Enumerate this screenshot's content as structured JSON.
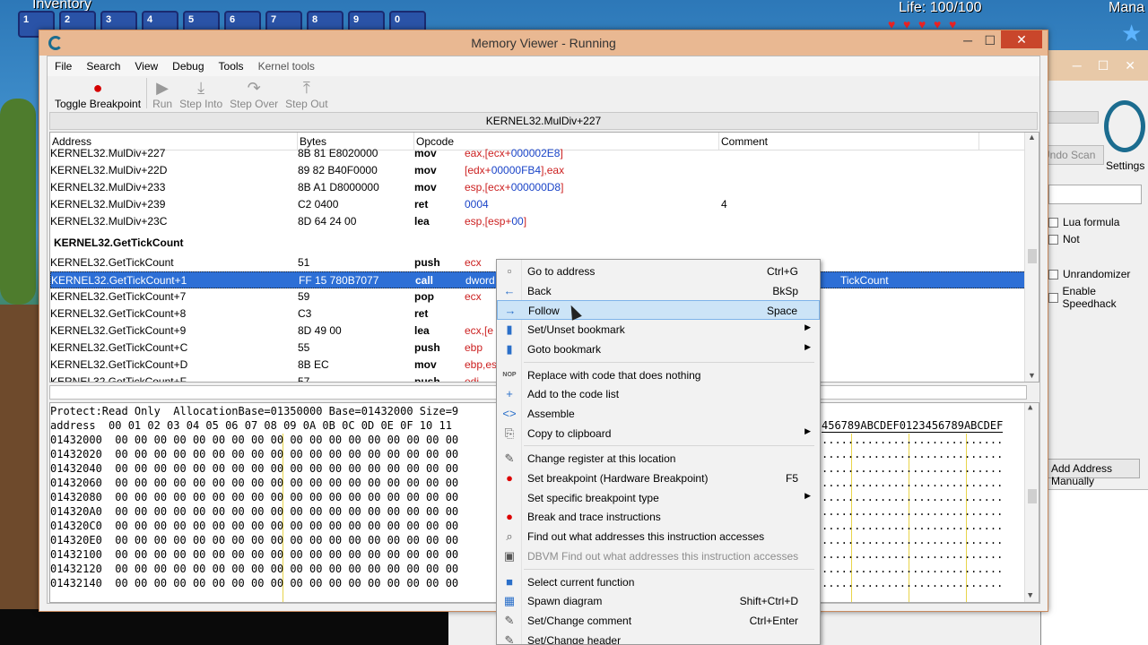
{
  "game": {
    "inventory_label": "Inventory",
    "hotbar": [
      "1",
      "2",
      "3",
      "4",
      "5",
      "6",
      "7",
      "8",
      "9",
      "0"
    ],
    "life": "Life: 100/100",
    "mana": "Mana"
  },
  "main_window": {
    "undo_scan": "Undo Scan",
    "settings": "Settings",
    "checks": [
      "Lua formula",
      "Not",
      "Unrandomizer",
      "Enable Speedhack"
    ],
    "add_address": "Add Address Manually"
  },
  "window": {
    "title": "Memory Viewer - Running",
    "minimize": "─",
    "maximize": "☐",
    "close": "✕"
  },
  "menubar": [
    "File",
    "Search",
    "View",
    "Debug",
    "Tools",
    "Kernel tools"
  ],
  "toolbar": {
    "toggle_breakpoint": "Toggle Breakpoint",
    "run": "Run",
    "step_into": "Step Into",
    "step_over": "Step Over",
    "step_out": "Step Out"
  },
  "location": "KERNEL32.MulDiv+227",
  "disasm": {
    "headers": [
      "Address",
      "Bytes",
      "Opcode",
      "Comment"
    ],
    "rows": [
      {
        "addr": "KERNEL32.MulDiv+227",
        "bytes": "8B 81 E8020000",
        "op": "mov",
        "args": "eax,[ecx+000002E8]",
        "comment": ""
      },
      {
        "addr": "KERNEL32.MulDiv+22D",
        "bytes": "89 82 B40F0000",
        "op": "mov",
        "args": "[edx+00000FB4],eax",
        "comment": ""
      },
      {
        "addr": "KERNEL32.MulDiv+233",
        "bytes": "8B A1 D8000000",
        "op": "mov",
        "args": "esp,[ecx+000000D8]",
        "comment": ""
      },
      {
        "addr": "KERNEL32.MulDiv+239",
        "bytes": "C2 0400",
        "op": "ret",
        "args": "0004",
        "comment": "4"
      },
      {
        "addr": "KERNEL32.MulDiv+23C",
        "bytes": "8D 64 24 00",
        "op": "lea",
        "args": "esp,[esp+00]",
        "comment": ""
      },
      {
        "label": "KERNEL32.GetTickCount"
      },
      {
        "addr": "KERNEL32.GetTickCount",
        "bytes": "51",
        "op": "push",
        "args": "ecx",
        "comment": ""
      },
      {
        "addr": "KERNEL32.GetTickCount+1",
        "bytes": "FF 15 780B7077",
        "op": "call",
        "args": "dword",
        "comment": "TickCount",
        "selected": true
      },
      {
        "addr": "KERNEL32.GetTickCount+7",
        "bytes": "59",
        "op": "pop",
        "args": "ecx",
        "comment": ""
      },
      {
        "addr": "KERNEL32.GetTickCount+8",
        "bytes": "C3",
        "op": "ret",
        "args": "",
        "comment": ""
      },
      {
        "addr": "KERNEL32.GetTickCount+9",
        "bytes": "8D 49 00",
        "op": "lea",
        "args": "ecx,[e",
        "comment": ""
      },
      {
        "addr": "KERNEL32.GetTickCount+C",
        "bytes": "55",
        "op": "push",
        "args": "ebp",
        "comment": ""
      },
      {
        "addr": "KERNEL32.GetTickCount+D",
        "bytes": "8B EC",
        "op": "mov",
        "args": "ebp,es",
        "comment": ""
      },
      {
        "addr": "KERNEL32.GetTickCount+F",
        "bytes": "57",
        "op": "push",
        "args": "edi",
        "comment": ""
      }
    ]
  },
  "hex": {
    "protect": "Protect:Read Only  AllocationBase=01350000 Base=01432000 Size=9",
    "header": "address  00 01 02 03 04 05 06 07 08 09 0A 0B 0C 0D 0E 0F 10 11",
    "header_ascii": "456789ABCDEF0123456789ABCDEF",
    "addresses": [
      "01432000",
      "01432020",
      "01432040",
      "01432060",
      "01432080",
      "014320A0",
      "014320C0",
      "014320E0",
      "01432100",
      "01432120",
      "01432140"
    ],
    "bytes": "00 00 00 00 00 00 00 00 00 00 00 00 00 00 00 00 00 00",
    "ascii": "............................"
  },
  "context_menu": [
    {
      "icon": "page-icon",
      "glyph": "▫",
      "label": "Go to address",
      "shortcut": "Ctrl+G"
    },
    {
      "icon": "arrow-left-icon",
      "glyph": "←",
      "label": "Back",
      "shortcut": "BkSp"
    },
    {
      "icon": "arrow-right-icon",
      "glyph": "→",
      "label": "Follow",
      "shortcut": "Space",
      "highlight": true
    },
    {
      "icon": "bookmark-icon",
      "glyph": "▮",
      "label": "Set/Unset bookmark",
      "submenu": true
    },
    {
      "icon": "bookmark-goto-icon",
      "glyph": "▮",
      "label": "Goto bookmark",
      "submenu": true
    },
    {
      "sep": true
    },
    {
      "icon": "nop-icon",
      "glyph": "NOP",
      "label": "Replace with code that does nothing"
    },
    {
      "icon": "plus-icon",
      "glyph": "+",
      "label": "Add to the code list"
    },
    {
      "icon": "code-icon",
      "glyph": "<>",
      "label": "Assemble"
    },
    {
      "icon": "copy-icon",
      "glyph": "⎘",
      "label": "Copy to clipboard",
      "submenu": true
    },
    {
      "sep": true
    },
    {
      "icon": "edit-icon",
      "glyph": "✎",
      "label": "Change register at this location"
    },
    {
      "icon": "breakpoint-icon",
      "glyph": "●",
      "label": "Set breakpoint (Hardware Breakpoint)",
      "shortcut": "F5"
    },
    {
      "icon": "none",
      "glyph": "",
      "label": "Set specific breakpoint type",
      "submenu": true
    },
    {
      "icon": "trace-icon",
      "glyph": "●",
      "label": "Break and trace instructions"
    },
    {
      "icon": "magnifier-icon",
      "glyph": "⌕",
      "label": "Find out what addresses this instruction accesses"
    },
    {
      "icon": "dbvm-icon",
      "glyph": "▣",
      "label": "DBVM Find out what addresses this instruction accesses",
      "disabled": true
    },
    {
      "sep": true
    },
    {
      "icon": "function-icon",
      "glyph": "■",
      "label": "Select current function"
    },
    {
      "icon": "diagram-icon",
      "glyph": "▦",
      "label": "Spawn diagram",
      "shortcut": "Shift+Ctrl+D"
    },
    {
      "icon": "comment-icon",
      "glyph": "✎",
      "label": "Set/Change comment",
      "shortcut": "Ctrl+Enter"
    },
    {
      "icon": "header-icon",
      "glyph": "✎",
      "label": "Set/Change header"
    }
  ],
  "colors": {
    "title_bar": "#e9b892",
    "close": "#c9462b",
    "selection": "#2d6fd6",
    "menu_highlight": "#cce4f7",
    "register": "#cc2020",
    "number": "#1a44c8"
  }
}
